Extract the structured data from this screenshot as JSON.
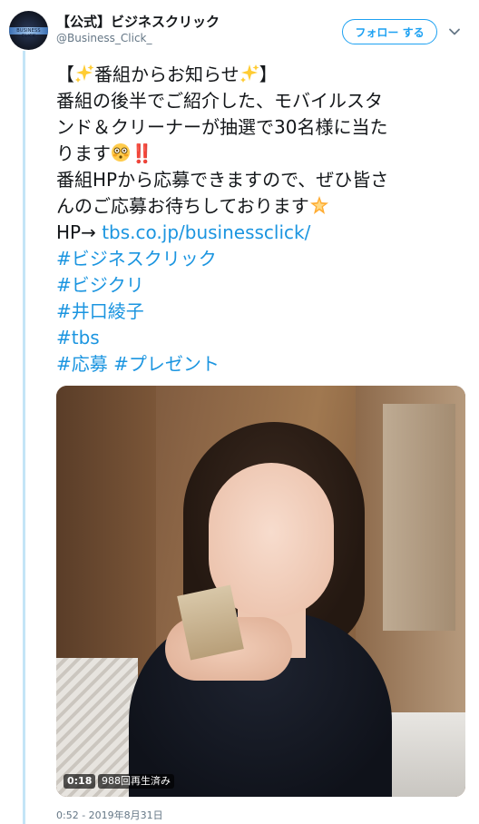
{
  "account": {
    "display_name": "【公式】ビジネスクリック",
    "handle": "@Business_Click_",
    "avatar_text": "BUSINESS CLICK"
  },
  "follow_button": {
    "label": "フォロー する"
  },
  "tweet": {
    "lines": [
      {
        "parts": [
          {
            "text": "【"
          },
          {
            "emoji": "sparkles"
          },
          {
            "text": "番組からお知らせ"
          },
          {
            "emoji": "sparkles"
          },
          {
            "text": "】"
          }
        ]
      },
      {
        "parts": [
          {
            "text": "番組の後半でご紹介した、モバイルスタ"
          }
        ]
      },
      {
        "parts": [
          {
            "text": "ンド＆クリーナーが抽選で30名様に当た"
          }
        ]
      },
      {
        "parts": [
          {
            "text": "ります"
          },
          {
            "emoji": "flushed-face"
          },
          {
            "text": "‼️"
          }
        ]
      },
      {
        "parts": [
          {
            "text": "番組HPから応募できますので、ぜひ皆さ"
          }
        ]
      },
      {
        "parts": [
          {
            "text": "んのご応募お待ちしております"
          },
          {
            "emoji": "glowing-star"
          }
        ]
      },
      {
        "parts": [
          {
            "text": "HP→ "
          },
          {
            "link": "tbs.co.jp/businessclick/"
          }
        ]
      },
      {
        "parts": [
          {
            "link": "#ビジネスクリック"
          }
        ]
      },
      {
        "parts": [
          {
            "link": "#ビジクリ"
          }
        ]
      },
      {
        "parts": [
          {
            "link": "#井口綾子"
          }
        ]
      },
      {
        "parts": [
          {
            "link": "#tbs"
          }
        ]
      },
      {
        "parts": [
          {
            "link": "#応募"
          },
          {
            "text": " "
          },
          {
            "link": "#プレゼント"
          }
        ]
      }
    ]
  },
  "video": {
    "duration": "0:18",
    "views": "988回再生済み"
  },
  "timestamp": "0:52 - 2019年8月31日",
  "colors": {
    "link": "#1b95e0",
    "follow": "#1da1f2",
    "thread_line": "#c4e5f7"
  }
}
